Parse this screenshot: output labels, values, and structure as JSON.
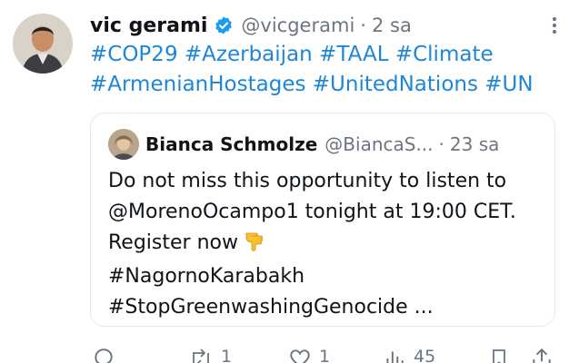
{
  "tweet": {
    "author": {
      "display_name": "vic gerami",
      "verified": true,
      "handle": "@vicgerami",
      "separator": "·",
      "time": "2 sa"
    },
    "hashtags_line1": [
      "#COP29",
      "#Azerbaijan",
      "#TAAL",
      "#Climate"
    ],
    "hashtags_line2": [
      "#ArmenianHostages",
      "#UnitedNations",
      "#UN"
    ],
    "colors": {
      "link": "#1d86d8",
      "verified": "#1d9bf0",
      "muted": "#6b7682",
      "border": "#e6eaee"
    }
  },
  "quoted": {
    "author": {
      "display_name": "Bianca Schmolze",
      "handle": "@BiancaS...",
      "separator": "·",
      "time": "23 sa"
    },
    "lines": [
      "Do  not miss this opportunity to listen to",
      "@MorenoOcampo1 tonight at 19:00 CET.",
      "Register now",
      "#NagornoKarabakh",
      "#StopGreenwashingGenocide ..."
    ],
    "emoji": "pointing-down-hand"
  },
  "actions": {
    "reply": {
      "icon": "reply-icon",
      "count": ""
    },
    "repost": {
      "icon": "repost-icon",
      "count": "1"
    },
    "like": {
      "icon": "heart-icon",
      "count": "1"
    },
    "views": {
      "icon": "views-icon",
      "count": "45"
    },
    "bookmark": {
      "icon": "bookmark-icon",
      "count": ""
    },
    "share": {
      "icon": "share-icon",
      "count": ""
    }
  }
}
